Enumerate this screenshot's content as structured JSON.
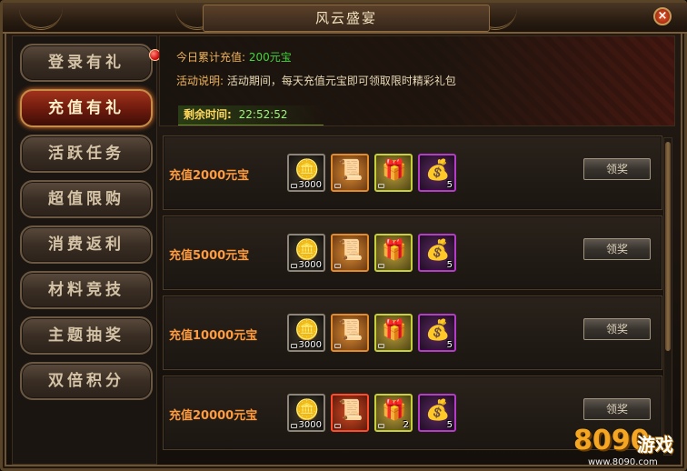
{
  "window": {
    "title": "风云盛宴",
    "close_label": "×"
  },
  "sidebar": {
    "items": [
      {
        "label": "登录有礼",
        "active": false,
        "has_dot": true
      },
      {
        "label": "充值有礼",
        "active": true,
        "has_dot": false
      },
      {
        "label": "活跃任务",
        "active": false,
        "has_dot": false
      },
      {
        "label": "超值限购",
        "active": false,
        "has_dot": false
      },
      {
        "label": "消费返利",
        "active": false,
        "has_dot": false
      },
      {
        "label": "材料竞技",
        "active": false,
        "has_dot": false
      },
      {
        "label": "主题抽奖",
        "active": false,
        "has_dot": false
      },
      {
        "label": "双倍积分",
        "active": false,
        "has_dot": false
      }
    ]
  },
  "info": {
    "recharge_key": "今日累计充值:",
    "recharge_value": "200元宝",
    "desc_key": "活动说明:",
    "desc_value": "活动期间，每天充值元宝即可领取限时精彩礼包",
    "timer_key": "剩余时间:",
    "timer_value": "22:52:52"
  },
  "rewards": [
    {
      "label": "充值2000元宝",
      "button": "领奖",
      "items": [
        {
          "icon": "gold-ingot-icon",
          "style": "gold",
          "count": "3000"
        },
        {
          "icon": "scroll-icon",
          "style": "scroll",
          "count": ""
        },
        {
          "icon": "red-bag-icon",
          "style": "bag",
          "count": ""
        },
        {
          "icon": "pouch-icon",
          "style": "pouch",
          "count": "5"
        }
      ]
    },
    {
      "label": "充值5000元宝",
      "button": "领奖",
      "items": [
        {
          "icon": "gold-ingot-icon",
          "style": "gold",
          "count": "3000"
        },
        {
          "icon": "scroll-icon",
          "style": "scroll",
          "count": ""
        },
        {
          "icon": "red-bag-icon",
          "style": "bag",
          "count": ""
        },
        {
          "icon": "pouch-icon",
          "style": "pouch",
          "count": "5"
        }
      ]
    },
    {
      "label": "充值10000元宝",
      "button": "领奖",
      "items": [
        {
          "icon": "gold-ingot-icon",
          "style": "gold",
          "count": "3000"
        },
        {
          "icon": "scroll-icon",
          "style": "scroll",
          "count": ""
        },
        {
          "icon": "red-bag-icon",
          "style": "bag",
          "count": ""
        },
        {
          "icon": "pouch-icon",
          "style": "pouch",
          "count": "5"
        }
      ]
    },
    {
      "label": "充值20000元宝",
      "button": "领奖",
      "items": [
        {
          "icon": "gold-ingot-icon",
          "style": "gold",
          "count": "3000"
        },
        {
          "icon": "scroll-icon",
          "style": "scroll-red",
          "count": ""
        },
        {
          "icon": "red-bag-icon",
          "style": "bag",
          "count": "2"
        },
        {
          "icon": "pouch-icon",
          "style": "pouch",
          "count": "5"
        }
      ]
    }
  ],
  "watermark": {
    "logo": "8090",
    "cn": "游戏",
    "url": "www.8090.com"
  },
  "colors": {
    "accent_orange": "#ff9b3d",
    "green_value": "#43d43c",
    "active_red": "#a1321c"
  }
}
